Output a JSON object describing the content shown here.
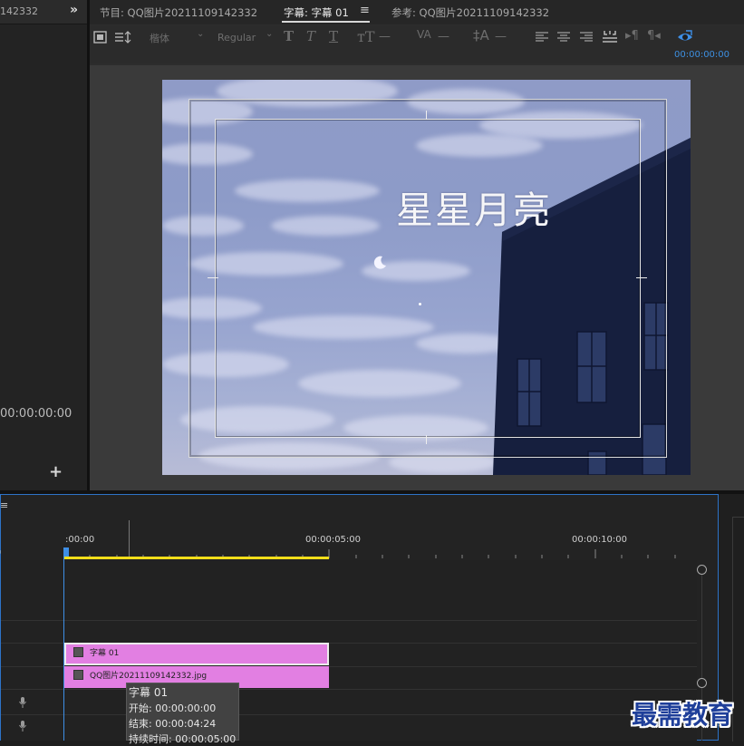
{
  "left_panel": {
    "tab_fragment": "142332",
    "overflow": "»",
    "timecode": "00:00:00:00",
    "add": "+"
  },
  "tabs": {
    "program": "节目: QQ图片20211109142332",
    "title": "字幕: 字幕 01",
    "menu": "≡",
    "reference": "参考: QQ图片20211109142332"
  },
  "toolbar": {
    "font_family": "楷体",
    "font_style": "Regular",
    "timecode": "00:00:00:00"
  },
  "canvas": {
    "title_text": "星星月亮"
  },
  "timeline": {
    "menu": "≡",
    "ruler": [
      ":00:00",
      "00:00:05:00",
      "00:00:10:00"
    ],
    "clips": {
      "title_clip": "字幕 01",
      "image_clip": "QQ图片20211109142332.jpg"
    },
    "tooltip": {
      "name": "字幕 01",
      "start": "开始: 00:00:00:00",
      "end": "结束: 00:00:04:24",
      "duration": "持续时间: 00:00:05:00"
    }
  },
  "watermark": "最需教育",
  "colors": {
    "accent_blue": "#3e8fe6",
    "clip_pink": "#e27fe2",
    "work_area_yellow": "#f2de1a",
    "watermark_blue": "#1f3f9a"
  },
  "icons": [
    "chevron-double-right-icon",
    "add-icon",
    "tab-menu-icon",
    "selection-tool-icon",
    "bold-icon",
    "italic-icon",
    "underline-icon",
    "font-size-icon",
    "kerning-icon",
    "leading-icon",
    "align-left-icon",
    "align-center-icon",
    "align-right-icon",
    "tab-stops-icon",
    "show-video-icon",
    "microphone-icon"
  ]
}
